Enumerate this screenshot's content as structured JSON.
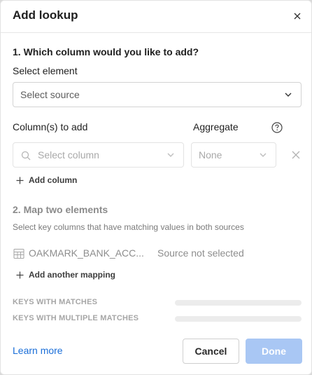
{
  "dialog": {
    "title": "Add lookup"
  },
  "section1": {
    "heading": "1. Which column would you like to add?",
    "select_element_label": "Select element",
    "source_placeholder": "Select source",
    "columns_label": "Column(s) to add",
    "aggregate_label": "Aggregate",
    "column_placeholder": "Select column",
    "aggregate_value": "None",
    "add_column_label": "Add column"
  },
  "section2": {
    "heading": "2. Map two elements",
    "description": "Select key columns that have matching values in both sources",
    "mapping_source": "OAKMARK_BANK_ACC...",
    "mapping_target": "Source not selected",
    "add_mapping_label": "Add another mapping"
  },
  "stats": {
    "keys_with_matches": "KEYS WITH MATCHES",
    "keys_with_multiple_matches": "KEYS WITH MULTIPLE MATCHES"
  },
  "footer": {
    "learn_more": "Learn more",
    "cancel": "Cancel",
    "done": "Done"
  },
  "colors": {
    "accent": "#1a6ed8",
    "done_disabled": "#a9c7f4"
  }
}
